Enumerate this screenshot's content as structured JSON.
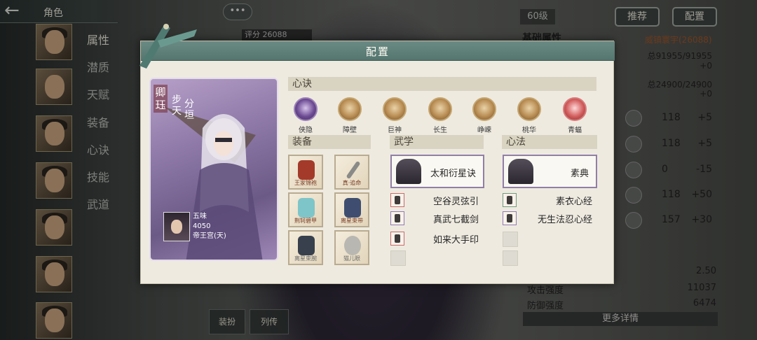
{
  "topbar": {
    "title": "角色"
  },
  "chat_button": "•••",
  "sidebar": {
    "tabs": [
      "属性",
      "潜质",
      "天赋",
      "装备",
      "心诀",
      "技能",
      "武道"
    ]
  },
  "top": {
    "level": "60级",
    "recommend": "推荐",
    "config": "配置"
  },
  "background": {
    "score": "评分 26088",
    "attr_title": "基础属性",
    "owner": "威镇寰宇(26088)",
    "line1": "总91955/91955",
    "line1b": "+0",
    "line2": "总24900/24900",
    "line2b": "+0",
    "rows": [
      {
        "value": "118",
        "diff": "+5"
      },
      {
        "value": "118",
        "diff": "+5"
      },
      {
        "value": "0",
        "diff": "-15"
      },
      {
        "value": "118",
        "diff": "+50"
      },
      {
        "value": "157",
        "diff": "+30"
      }
    ],
    "stats": [
      {
        "label": "",
        "value": "2.50"
      },
      {
        "label": "攻击强度",
        "value": "11037"
      },
      {
        "label": "防御强度",
        "value": "6474"
      }
    ],
    "more": "更多详情",
    "bottom_buttons": [
      "装扮",
      "列传"
    ]
  },
  "dialog": {
    "title": "配置",
    "card": {
      "name": "卿珏",
      "sect": "步天",
      "sect2": "分垣",
      "player_name": "五味",
      "player_score": "4050",
      "player_server": "帝王宫(天)"
    },
    "xinjue": {
      "header": "心诀",
      "items": [
        {
          "label": "侠隐",
          "style": "purple"
        },
        {
          "label": "障壁",
          "style": "gold"
        },
        {
          "label": "巨神",
          "style": "gold"
        },
        {
          "label": "长生",
          "style": "gold"
        },
        {
          "label": "峥嵘",
          "style": "gold"
        },
        {
          "label": "桃华",
          "style": "gold"
        },
        {
          "label": "青蝠",
          "style": "red"
        }
      ]
    },
    "equip": {
      "header": "装备",
      "items": [
        {
          "label": "王家锦袍",
          "color": "#a43b2a"
        },
        {
          "label": "真·追命",
          "color": "#8a8a88"
        },
        {
          "label": "荆轲碧甲",
          "color": "#7ec5c9"
        },
        {
          "label": "离星束带",
          "color": "#3f4e70"
        },
        {
          "label": "离星束腕",
          "color": "#38404d"
        },
        {
          "label": "猫儿眼",
          "color": "#b9b7b1"
        }
      ]
    },
    "wuxue": {
      "header": "武学",
      "main": "太和衍星诀",
      "skills": [
        "空谷灵弦引",
        "真武七截剑",
        "如来大手印"
      ]
    },
    "xinfa": {
      "header": "心法",
      "main": "素典",
      "skills": [
        "素衣心经",
        "无生法忍心经"
      ]
    }
  }
}
